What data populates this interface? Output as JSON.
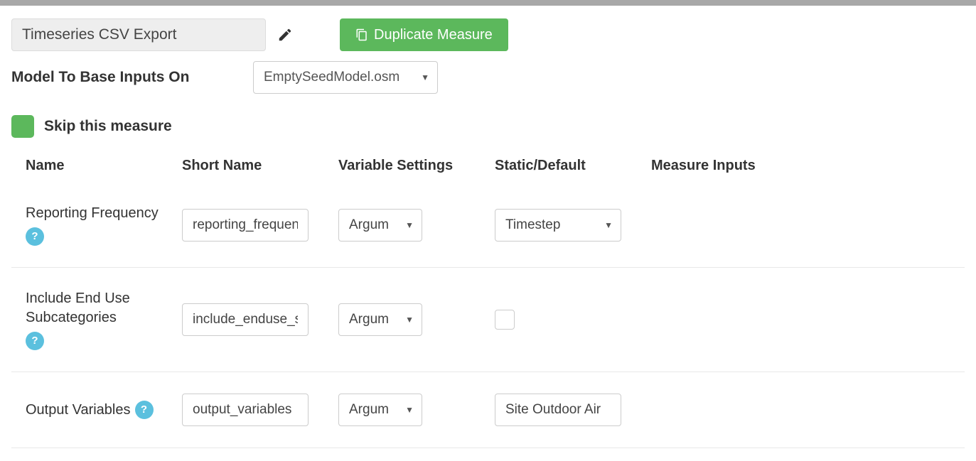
{
  "header": {
    "title_value": "Timeseries CSV Export",
    "duplicate_label": "Duplicate Measure"
  },
  "model": {
    "label": "Model To Base Inputs On",
    "selected": "EmptySeedModel.osm"
  },
  "skip": {
    "label": "Skip this measure"
  },
  "table": {
    "headers": {
      "name": "Name",
      "short_name": "Short Name",
      "variable_settings": "Variable Settings",
      "static_default": "Static/Default",
      "measure_inputs": "Measure Inputs"
    },
    "rows": [
      {
        "name": "Reporting Frequency",
        "short_name": "reporting_frequency",
        "variable_settings": "Argum",
        "default_type": "select",
        "default_value": "Timestep"
      },
      {
        "name": "Include End Use Subcategories",
        "short_name": "include_enduse_subcat",
        "variable_settings": "Argum",
        "default_type": "checkbox",
        "default_value": ""
      },
      {
        "name": "Output Variables",
        "short_name": "output_variables",
        "variable_settings": "Argum",
        "default_type": "text",
        "default_value": "Site Outdoor Air"
      }
    ]
  },
  "help_symbol": "?"
}
